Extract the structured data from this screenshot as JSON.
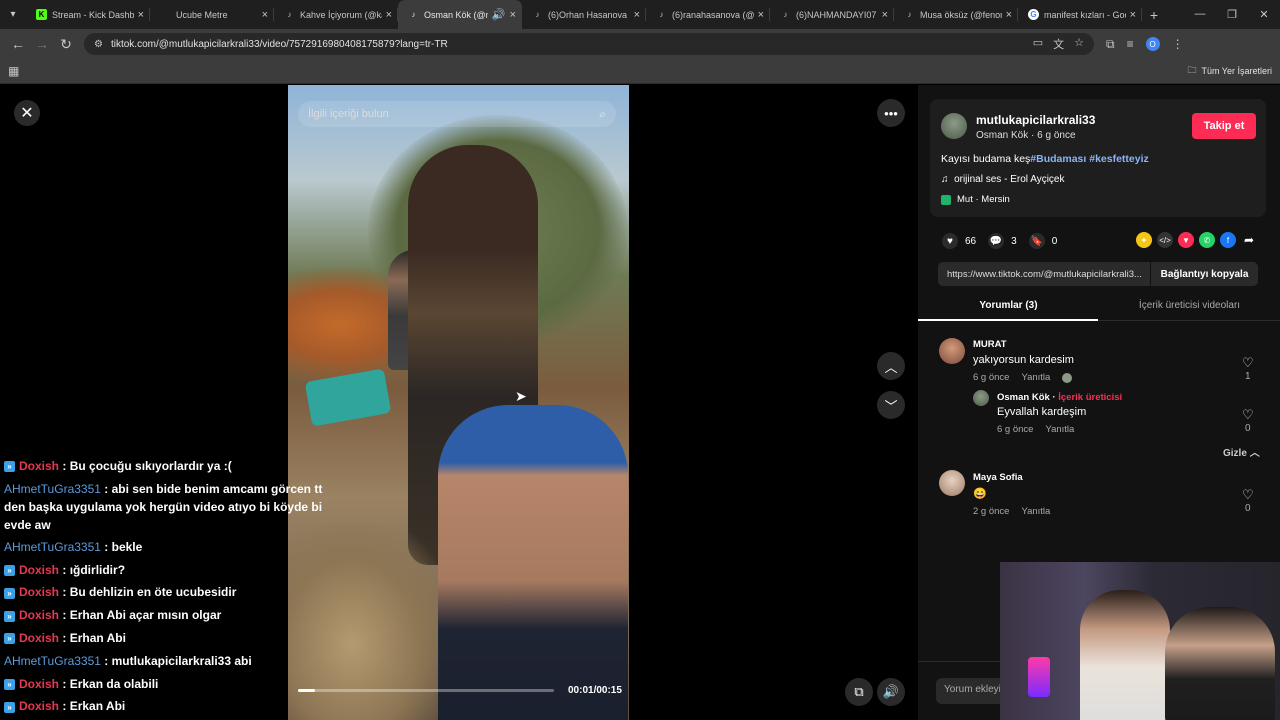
{
  "browser": {
    "tabs": [
      {
        "title": "Stream - Kick Dashbo",
        "icon": "kick-icon",
        "color": "#53fc18",
        "active": false
      },
      {
        "title": "Ucube Metre",
        "icon": "blank-icon",
        "color": "#1f1f1f",
        "active": false
      },
      {
        "title": "Kahve İçiyorum (@ka",
        "icon": "tiktok-icon",
        "color": "#000000",
        "active": false
      },
      {
        "title": "Osman Kök (@m",
        "icon": "tiktok-icon",
        "color": "#000000",
        "active": true
      },
      {
        "title": "(6)Orhan Hasanova (",
        "icon": "tiktok-icon",
        "color": "#000000",
        "active": false
      },
      {
        "title": "(6)ranahasanova (@",
        "icon": "tiktok-icon",
        "color": "#000000",
        "active": false
      },
      {
        "title": "(6)NAHMANDAYI07 (",
        "icon": "tiktok-icon",
        "color": "#000000",
        "active": false
      },
      {
        "title": "Musa öksüz (@fenom",
        "icon": "tiktok-icon",
        "color": "#000000",
        "active": false
      },
      {
        "title": "manifest kızları - Goo",
        "icon": "google-icon",
        "color": "#ffffff",
        "active": false
      }
    ],
    "url": "tiktok.com/@mutlukapicilarkrali33/video/7572916980408175879?lang=tr-TR",
    "bookmarks_all": "Tüm Yer İşaretleri",
    "profile_letter": "O"
  },
  "video": {
    "search_placeholder": "İlgili içeriği bulun",
    "time": "00:01/00:15",
    "progress_fraction": 0.067
  },
  "chat": [
    {
      "user": "Doxish",
      "user_color": "red",
      "badge": true,
      "message": ": Bu çocuğu sıkıyorlardır ya :("
    },
    {
      "user": "AHmetTuGra3351",
      "user_color": "blue",
      "badge": false,
      "message": ": abi sen bide benim amcamı görcen tt den başka uygulama yok hergün video atıyo bi köyde bi evde aw",
      "multi": true
    },
    {
      "user": "AHmetTuGra3351",
      "user_color": "blue",
      "badge": false,
      "message": ": bekle"
    },
    {
      "user": "Doxish",
      "user_color": "red",
      "badge": true,
      "message": ": ığdirlidir?"
    },
    {
      "user": "Doxish",
      "user_color": "red",
      "badge": true,
      "message": ": Bu dehlizin en öte ucubesidir"
    },
    {
      "user": "Doxish",
      "user_color": "red",
      "badge": true,
      "message": ": Erhan Abi açar mısın olgar"
    },
    {
      "user": "Doxish",
      "user_color": "red",
      "badge": true,
      "message": ": Erhan Abi"
    },
    {
      "user": "AHmetTuGra3351",
      "user_color": "blue",
      "badge": false,
      "message": ": mutlukapicilarkrali33 abi"
    },
    {
      "user": "Doxish",
      "user_color": "red",
      "badge": true,
      "message": ": Erkan da olabili"
    },
    {
      "user": "Doxish",
      "user_color": "red",
      "badge": true,
      "message": ": Erkan Abi"
    }
  ],
  "panel": {
    "author": "mutlukapicilarkrali33",
    "display_name": "Osman Kök",
    "posted": "6 g önce",
    "follow_label": "Takip et",
    "caption_text": "Kayısı budama keş",
    "caption_tags": "#Budaması #kesfetteyiz",
    "music": "orijinal ses - Erol Ayçiçek",
    "location": "Mut · Mersin",
    "likes": "66",
    "comments": "3",
    "saves": "0",
    "link": "https://www.tiktok.com/@mutlukapicilarkrali3...",
    "copy_label": "Bağlantıyı kopyala",
    "tab_comments": "Yorumlar (3)",
    "tab_creator_videos": "İçerik üreticisi videoları",
    "reply_label": "Yanıtla",
    "hide_label": "Gizle",
    "add_comment_placeholder": "Yorum ekleyi",
    "comment_list": [
      {
        "name": "MURAT",
        "text": "yakıyorsun kardesim",
        "time": "6 g önce",
        "likes": "1"
      },
      {
        "name": "Osman Kök",
        "creator_label": "İçerik üreticisi",
        "text": "Eyvallah kardeşim",
        "time": "6 g önce",
        "likes": "0"
      },
      {
        "name": "Maya Sofia",
        "text": "😄",
        "time": "2 g önce",
        "likes": "0"
      }
    ]
  },
  "colors": {
    "accent": "#fe2c55",
    "tag": "#8ab4f8",
    "chat_red": "#e53950",
    "chat_blue": "#5b9bdc"
  }
}
